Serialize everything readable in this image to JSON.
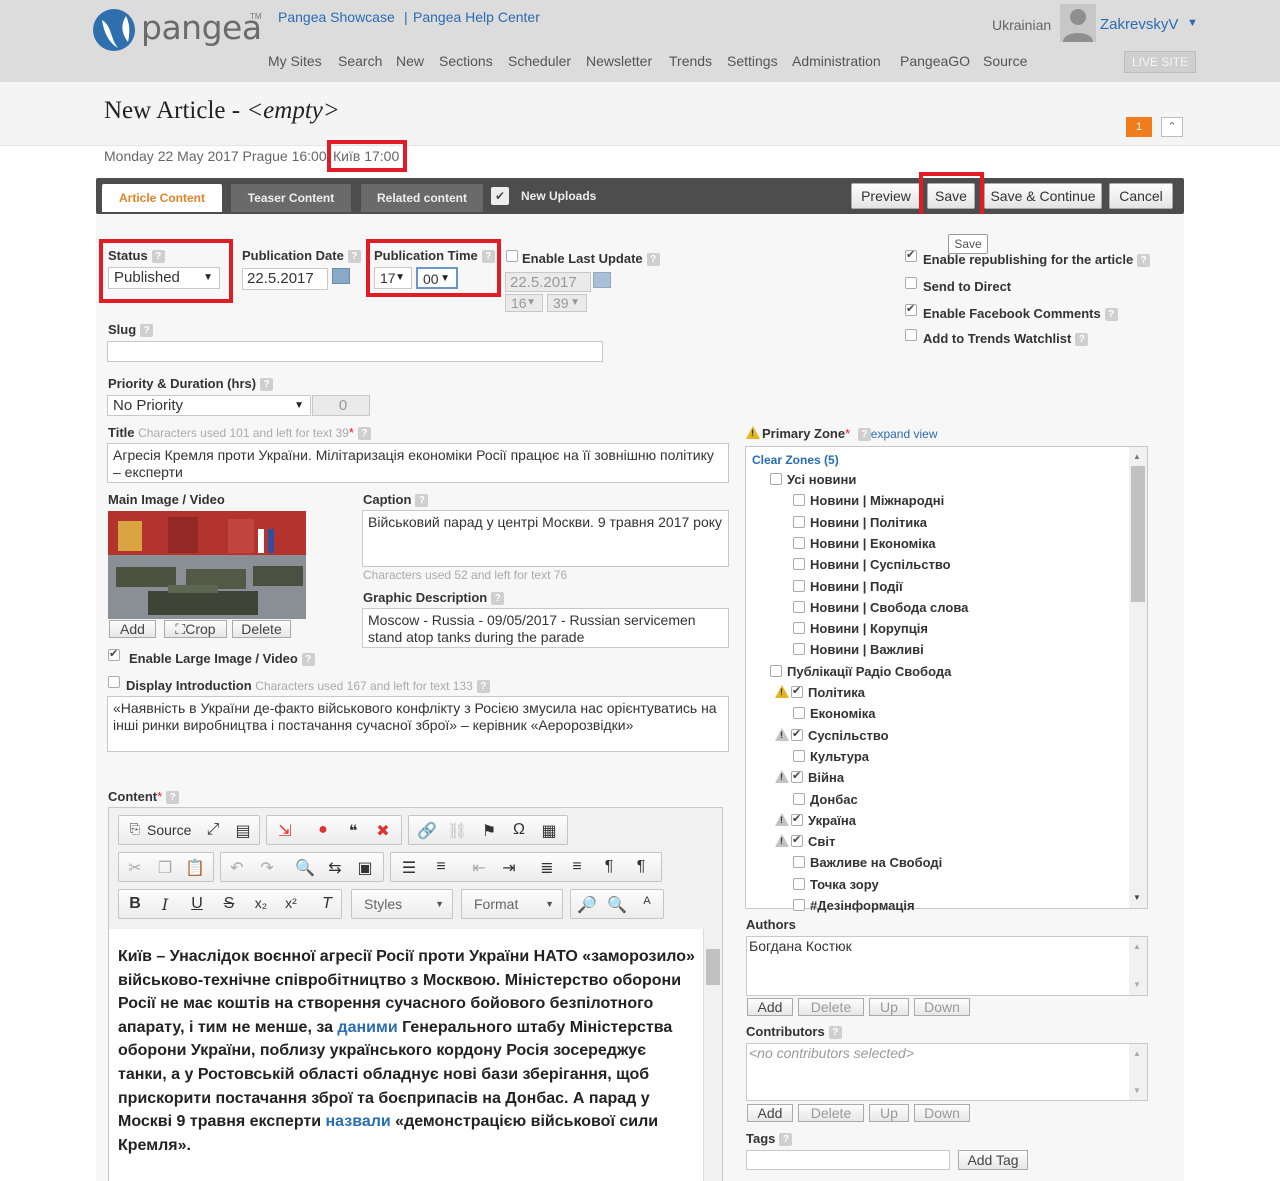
{
  "header": {
    "logo_text": "pangea",
    "logo_tm": "TM",
    "links": [
      "Pangea Showcase",
      "Pangea Help Center"
    ],
    "link_separator": "|",
    "nav": [
      "My Sites",
      "Search",
      "New",
      "Sections",
      "Scheduler",
      "Newsletter",
      "Trends",
      "Settings",
      "Administration",
      "PangeaGO",
      "Source"
    ],
    "language": "Ukrainian",
    "username": "ZakrevskyV",
    "live_site": "LIVE SITE"
  },
  "page": {
    "title_prefix": "New Article -",
    "title_empty": "<empty>",
    "notification_count": "1",
    "date_line": "Monday 22 May 2017 Prague 16:00",
    "kyiv_time": "Київ 17:00"
  },
  "tabs": [
    "Article Content",
    "Teaser Content",
    "Related content",
    "New Uploads"
  ],
  "actions": {
    "preview": "Preview",
    "save": "Save",
    "save_continue": "Save & Continue",
    "cancel": "Cancel",
    "save_tooltip": "Save"
  },
  "form": {
    "status": {
      "label": "Status",
      "value": "Published"
    },
    "publication_date": {
      "label": "Publication Date",
      "value": "22.5.2017"
    },
    "publication_time": {
      "label": "Publication Time",
      "hour": "17",
      "minute": "00"
    },
    "last_update": {
      "label": "Enable Last Update",
      "date": "22.5.2017",
      "hour": "16",
      "minute": "39"
    },
    "options": [
      {
        "label": "Enable republishing for the article",
        "checked": true
      },
      {
        "label": "Send to Direct",
        "checked": false
      },
      {
        "label": "Enable Facebook Comments",
        "checked": true
      },
      {
        "label": "Add to Trends Watchlist",
        "checked": false
      }
    ],
    "slug": {
      "label": "Slug",
      "value": ""
    },
    "priority": {
      "label": "Priority & Duration (hrs)",
      "value": "No Priority",
      "duration": "0"
    },
    "title": {
      "label": "Title",
      "note": "Characters used 101 and left for text 39",
      "required": "*",
      "value": "Агресія Кремля проти України. Мілітаризація економіки Росії працює на її зовнішню політику – експерти"
    },
    "main_image": {
      "label": "Main Image / Video",
      "add": "Add",
      "crop": "Crop",
      "delete": "Delete"
    },
    "caption": {
      "label": "Caption",
      "value": "Військовий парад у центрі Москви. 9 травня 2017 року",
      "note": "Characters used 52 and left for text 76"
    },
    "graphic_description": {
      "label": "Graphic Description",
      "value": "Moscow - Russia - 09/05/2017 - Russian servicemen stand atop tanks during the parade"
    },
    "enable_large_image": {
      "label": "Enable Large Image / Video",
      "checked": true
    },
    "display_introduction": {
      "label": "Display Introduction",
      "checked": false,
      "note": "Characters used 167 and left for text 133"
    },
    "introduction": "«Наявність в України де-факто військового конфлікту з Росією змусила нас орієнтуватись на інші ринки виробництва і постачання сучасної зброї» – керівник «Аеророзвідки»",
    "content_label": "Content",
    "content_required": "*"
  },
  "editor": {
    "source": "Source",
    "styles": "Styles",
    "format": "Format",
    "body_1": "Київ – Унаслідок воєнної агресії Росії проти України НАТО «заморозило» військово-технічне співробітництво з Москвою. Міністерство оборони Росії не має коштів на створення сучасного бойового безпілотного апарату, і тим не менше, за ",
    "body_link_1": "даними",
    "body_2": " Генерального штабу Міністерства оборони України, поблизу українського кордону Росія зосереджує танки, а у Ростовській області обладнує нові бази зберігання, щоб прискорити постачання зброї та боєприпасів на Донбас. А парад у Москві 9 травня експерти ",
    "body_link_2": "назвали",
    "body_3": " «демонстрацією військової сили Кремля»."
  },
  "zones": {
    "label": "Primary Zone",
    "required": "*",
    "expand": "expand view",
    "clear": "Clear Zones (5)",
    "items": [
      {
        "label": "Усі новини",
        "level": 0,
        "checked": false,
        "warn": ""
      },
      {
        "label": "Новини | Міжнародні",
        "level": 1,
        "checked": false,
        "warn": ""
      },
      {
        "label": "Новини | Політика",
        "level": 1,
        "checked": false,
        "warn": ""
      },
      {
        "label": "Новини | Економіка",
        "level": 1,
        "checked": false,
        "warn": ""
      },
      {
        "label": "Новини | Суспільство",
        "level": 1,
        "checked": false,
        "warn": ""
      },
      {
        "label": "Новини | Події",
        "level": 1,
        "checked": false,
        "warn": ""
      },
      {
        "label": "Новини | Свобода слова",
        "level": 1,
        "checked": false,
        "warn": ""
      },
      {
        "label": "Новини | Корупція",
        "level": 1,
        "checked": false,
        "warn": ""
      },
      {
        "label": "Новини | Важливі",
        "level": 1,
        "checked": false,
        "warn": ""
      },
      {
        "label": "Публікації Радіо Свобода",
        "level": 0,
        "checked": false,
        "warn": ""
      },
      {
        "label": "Політика",
        "level": 1,
        "checked": true,
        "warn": "yellow"
      },
      {
        "label": "Економіка",
        "level": 1,
        "checked": false,
        "warn": ""
      },
      {
        "label": "Суспільство",
        "level": 1,
        "checked": true,
        "warn": "grey"
      },
      {
        "label": "Культура",
        "level": 1,
        "checked": false,
        "warn": ""
      },
      {
        "label": "Війна",
        "level": 1,
        "checked": true,
        "warn": "grey"
      },
      {
        "label": "Донбас",
        "level": 1,
        "checked": false,
        "warn": ""
      },
      {
        "label": "Україна",
        "level": 1,
        "checked": true,
        "warn": "grey"
      },
      {
        "label": "Світ",
        "level": 1,
        "checked": true,
        "warn": "grey"
      },
      {
        "label": "Важливе на Свободі",
        "level": 1,
        "checked": false,
        "warn": ""
      },
      {
        "label": "Точка зору",
        "level": 1,
        "checked": false,
        "warn": ""
      },
      {
        "label": "#Дезінформація",
        "level": 1,
        "checked": false,
        "warn": ""
      }
    ]
  },
  "authors": {
    "label": "Authors",
    "value": "Богдана Костюк",
    "add": "Add",
    "delete": "Delete",
    "up": "Up",
    "down": "Down"
  },
  "contributors": {
    "label": "Contributors",
    "value": "<no contributors selected>",
    "add": "Add",
    "delete": "Delete",
    "up": "Up",
    "down": "Down"
  },
  "tags": {
    "label": "Tags",
    "add": "Add Tag"
  },
  "colors": {
    "accent": "#e2832a",
    "link": "#2a6cb3",
    "highlight": "#e21b24",
    "badge": "#f07c1c"
  }
}
